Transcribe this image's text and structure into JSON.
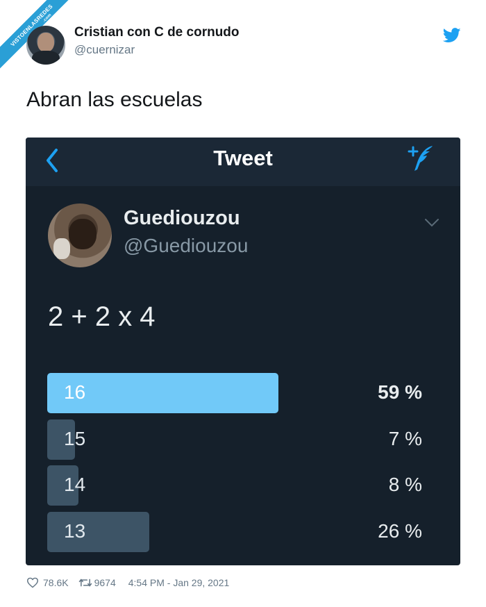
{
  "watermark": {
    "text": "VISTOENLASREDES",
    "suffix": ".com"
  },
  "author": {
    "name": "Cristian con C de cornudo",
    "handle": "@cuernizar"
  },
  "tweet_text": "Abran las escuelas",
  "embedded": {
    "header_title": "Tweet",
    "name": "Guediouzou",
    "handle": "@Guediouzou",
    "text": "2 + 2 x 4",
    "poll": [
      {
        "label": "16",
        "pct_text": "59 %",
        "fraction": 0.59,
        "leader": true
      },
      {
        "label": "15",
        "pct_text": "7 %",
        "fraction": 0.07,
        "leader": false
      },
      {
        "label": "14",
        "pct_text": "8 %",
        "fraction": 0.08,
        "leader": false
      },
      {
        "label": "13",
        "pct_text": "26 %",
        "fraction": 0.26,
        "leader": false
      }
    ]
  },
  "footer": {
    "likes": "78.6K",
    "retweets": "9674",
    "timestamp": "4:54 PM - Jan 29, 2021"
  },
  "icons": {
    "bird": "twitter-bird-icon",
    "back": "chevron-left-icon",
    "compose": "compose-tweet-icon",
    "chevron": "chevron-down-icon",
    "like": "heart-icon",
    "retweet": "retweet-icon"
  },
  "colors": {
    "brand": "#1da1f2",
    "poll_leader": "#71c9f8",
    "poll_other": "#3d5466",
    "dark_bg": "#15202b"
  }
}
